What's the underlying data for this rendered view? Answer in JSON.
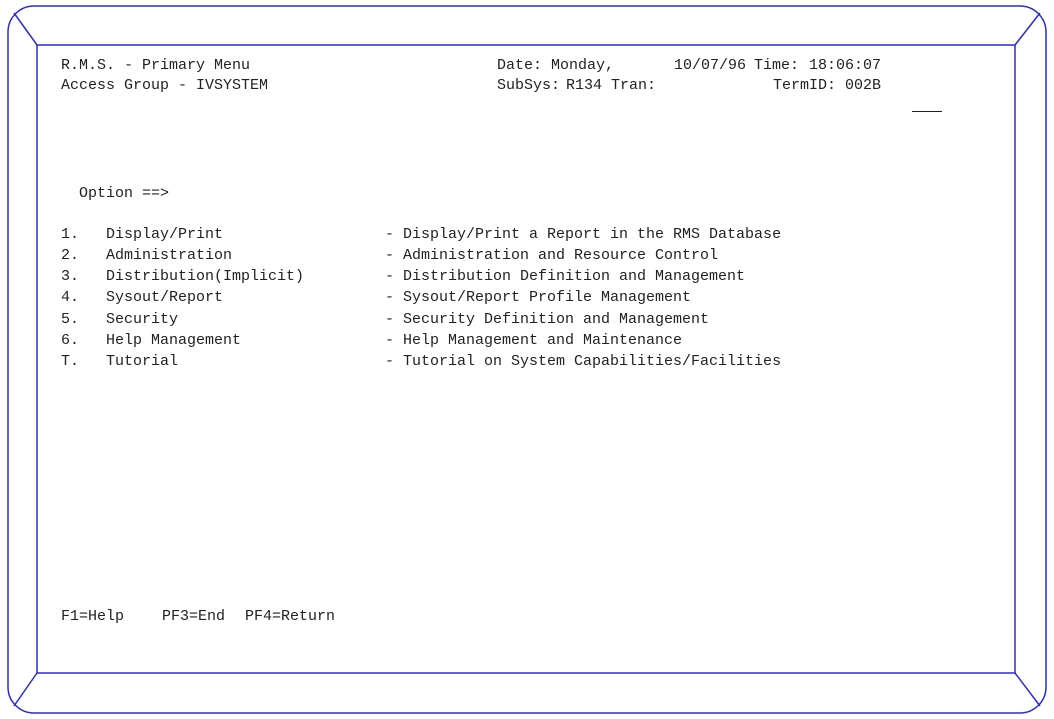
{
  "colors": {
    "frame": "#2a2ad6",
    "text": "#222222",
    "background": "#ffffff"
  },
  "header": {
    "title": "R.M.S. - Primary Menu",
    "access_group": "Access Group - IVSYSTEM",
    "date_label": "Date: Monday,",
    "date_value": "10/07/96",
    "time_label": "Time:",
    "time_value": "18:06:07",
    "subsys_label": "SubSys:",
    "subsys_value": "R134",
    "tran_label": "Tran:",
    "termid_label": "TermID:",
    "termid_value": "002B"
  },
  "option_prompt": "Option ==>",
  "menu": [
    {
      "key": "1.",
      "name": "Display/Print",
      "desc": "- Display/Print a Report in the RMS Database"
    },
    {
      "key": "2.",
      "name": "Administration",
      "desc": "- Administration and Resource Control"
    },
    {
      "key": "3.",
      "name": "Distribution(Implicit)",
      "desc": "- Distribution Definition and Management"
    },
    {
      "key": "4.",
      "name": "Sysout/Report",
      "desc": "- Sysout/Report Profile Management"
    },
    {
      "key": "5.",
      "name": "Security",
      "desc": "- Security Definition and Management"
    },
    {
      "key": "6.",
      "name": "Help Management",
      "desc": "- Help Management and Maintenance"
    },
    {
      "key": "T.",
      "name": "Tutorial",
      "desc": "- Tutorial on System Capabilities/Facilities"
    }
  ],
  "function_keys": [
    {
      "label": "F1=Help"
    },
    {
      "label": "PF3=End"
    },
    {
      "label": "PF4=Return"
    }
  ]
}
